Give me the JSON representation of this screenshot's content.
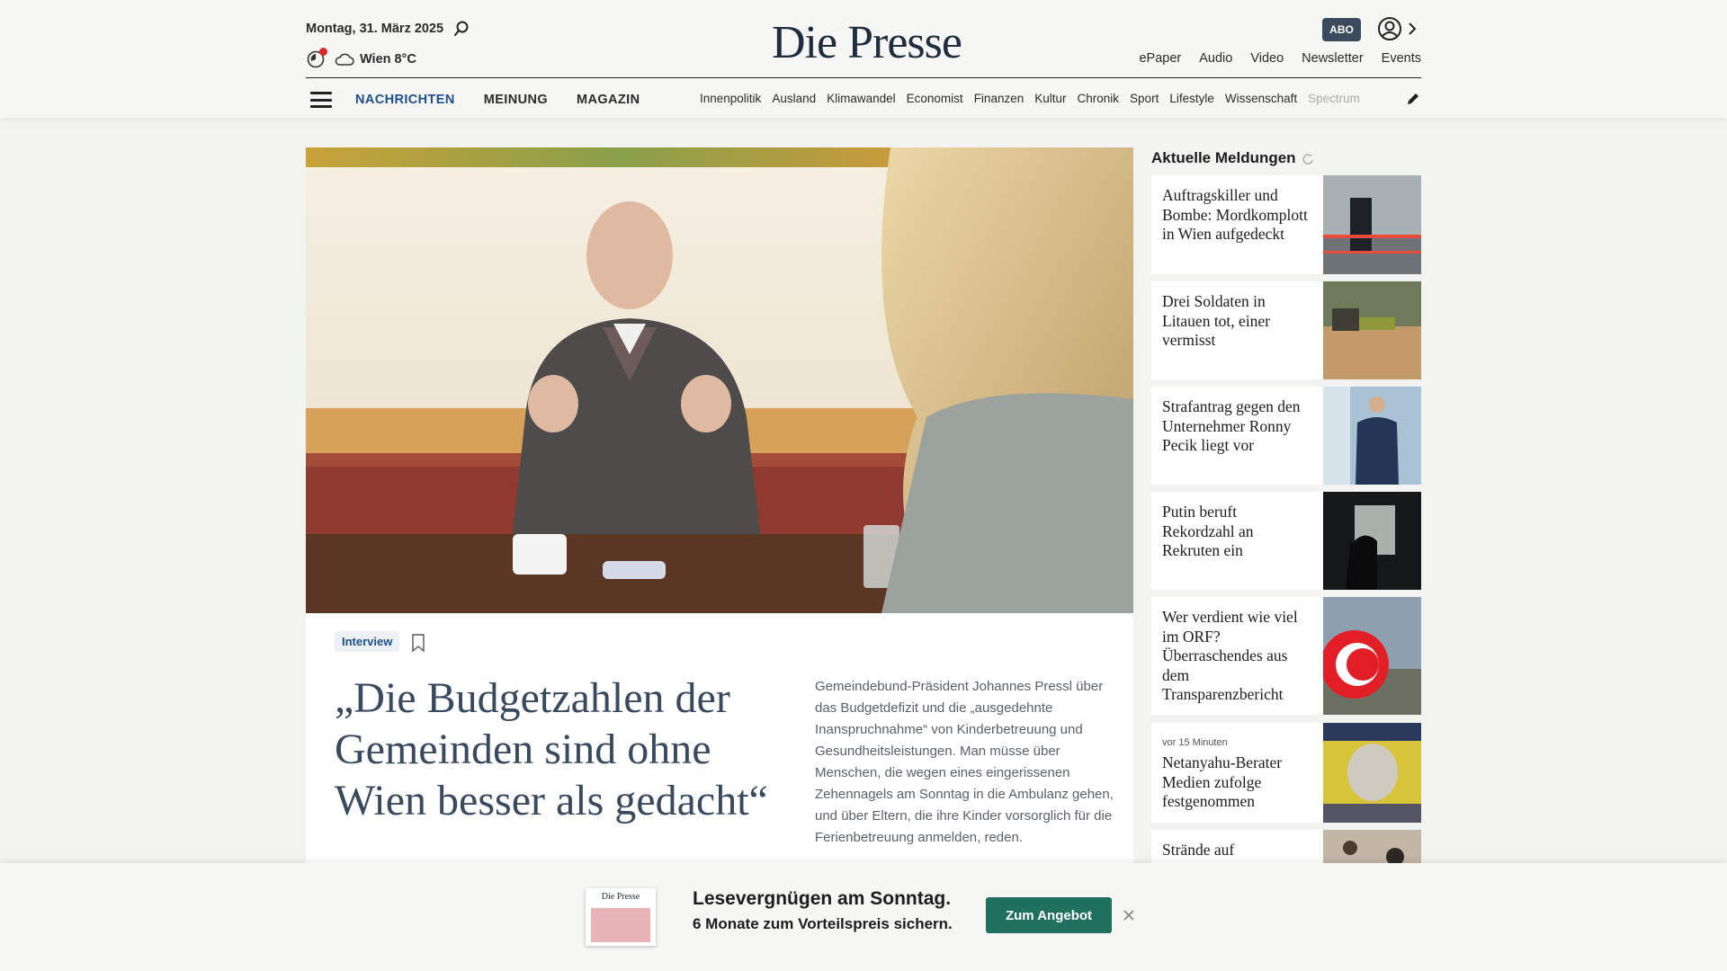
{
  "header": {
    "date": "Montag, 31. März 2025",
    "weather": "Wien 8°C",
    "logo": "Die Presse",
    "abo_label": "ABO",
    "top_links": [
      "ePaper",
      "Audio",
      "Video",
      "Newsletter",
      "Events"
    ]
  },
  "nav": {
    "main": [
      "NACHRICHTEN",
      "MEINUNG",
      "MAGAZIN"
    ],
    "sub": [
      "Innenpolitik",
      "Ausland",
      "Klimawandel",
      "Economist",
      "Finanzen",
      "Kultur",
      "Chronik",
      "Sport",
      "Lifestyle",
      "Wissenschaft",
      "Spectrum"
    ]
  },
  "article": {
    "tag": "Interview",
    "headline": "„Die Budgetzahlen der Gemeinden sind ohne Wien besser als gedacht“",
    "lead": "Gemeindebund-Präsident Johannes Pressl über das Budgetdefizit und die „ausgedehnte Inanspruchnahme“ von Kinderbetreuung und Gesundheitsleistungen. Man müsse über Menschen, die wegen eines eingerissenen Zehennagels am Sonntag in die Ambulanz gehen, und über Eltern, die ihre Kinder vorsorglich für die Ferienbetreuung anmelden, reden."
  },
  "sidebar": {
    "title": "Aktuelle Meldungen",
    "items": [
      {
        "title": "Auftragskiller und Bombe: Mordkomplott in Wien aufgedeckt",
        "time": ""
      },
      {
        "title": "Drei Soldaten in Litauen tot, einer vermisst",
        "time": ""
      },
      {
        "title": "Strafantrag gegen den Unternehmer Ronny Pecik liegt vor",
        "time": ""
      },
      {
        "title": "Putin beruft Rekordzahl an Rekruten ein",
        "time": ""
      },
      {
        "title": "Wer verdient wie viel im ORF? Überraschendes aus dem Transparenzbericht",
        "time": ""
      },
      {
        "title": "Netanyahu-Berater Medien zufolge festgenommen",
        "time": "vor 15 Minuten"
      },
      {
        "title": "Strände auf",
        "time": ""
      }
    ]
  },
  "promo": {
    "cover_logo": "Die Presse",
    "line1": "Lesevergnügen am Sonntag.",
    "line2": "6 Monate zum Vorteilspreis sichern.",
    "button": "Zum Angebot"
  }
}
